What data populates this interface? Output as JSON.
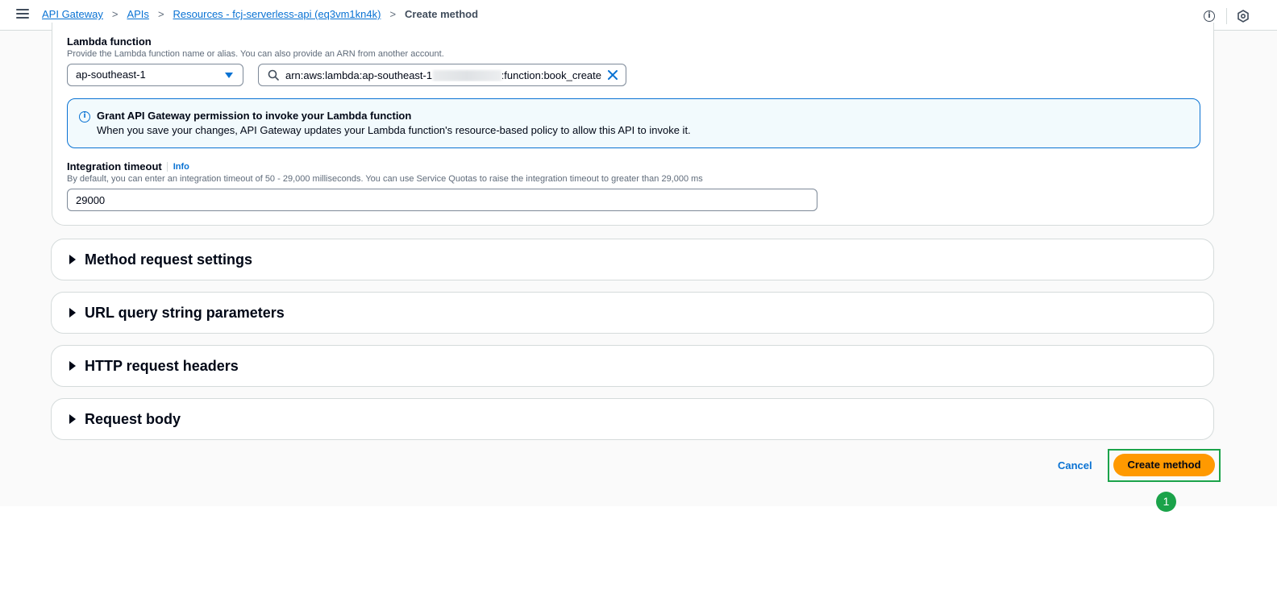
{
  "breadcrumb": {
    "items": [
      "API Gateway",
      "APIs",
      "Resources - fcj-serverless-api (eq3vm1kn4k)"
    ],
    "current": "Create method",
    "separator": ">"
  },
  "lambda": {
    "label": "Lambda function",
    "description": "Provide the Lambda function name or alias. You can also provide an ARN from another account.",
    "region_value": "ap-southeast-1",
    "arn_prefix": "arn:aws:lambda:ap-southeast-1",
    "arn_suffix": ":function:book_create"
  },
  "alert": {
    "title": "Grant API Gateway permission to invoke your Lambda function",
    "body": "When you save your changes, API Gateway updates your Lambda function's resource-based policy to allow this API to invoke it."
  },
  "timeout": {
    "label": "Integration timeout",
    "info_link": "Info",
    "description": "By default, you can enter an integration timeout of 50 - 29,000 milliseconds. You can use Service Quotas to raise the integration timeout to greater than 29,000 ms",
    "value": "29000"
  },
  "sections": [
    {
      "title": "Method request settings"
    },
    {
      "title": "URL query string parameters"
    },
    {
      "title": "HTTP request headers"
    },
    {
      "title": "Request body"
    }
  ],
  "actions": {
    "cancel_label": "Cancel",
    "create_label": "Create method"
  },
  "annotation": {
    "step_number": "1"
  },
  "colors": {
    "primary_button": "#ff9900",
    "link": "#0972d3",
    "highlight": "#1ba34a",
    "info_alert_bg": "#f2fafd"
  }
}
